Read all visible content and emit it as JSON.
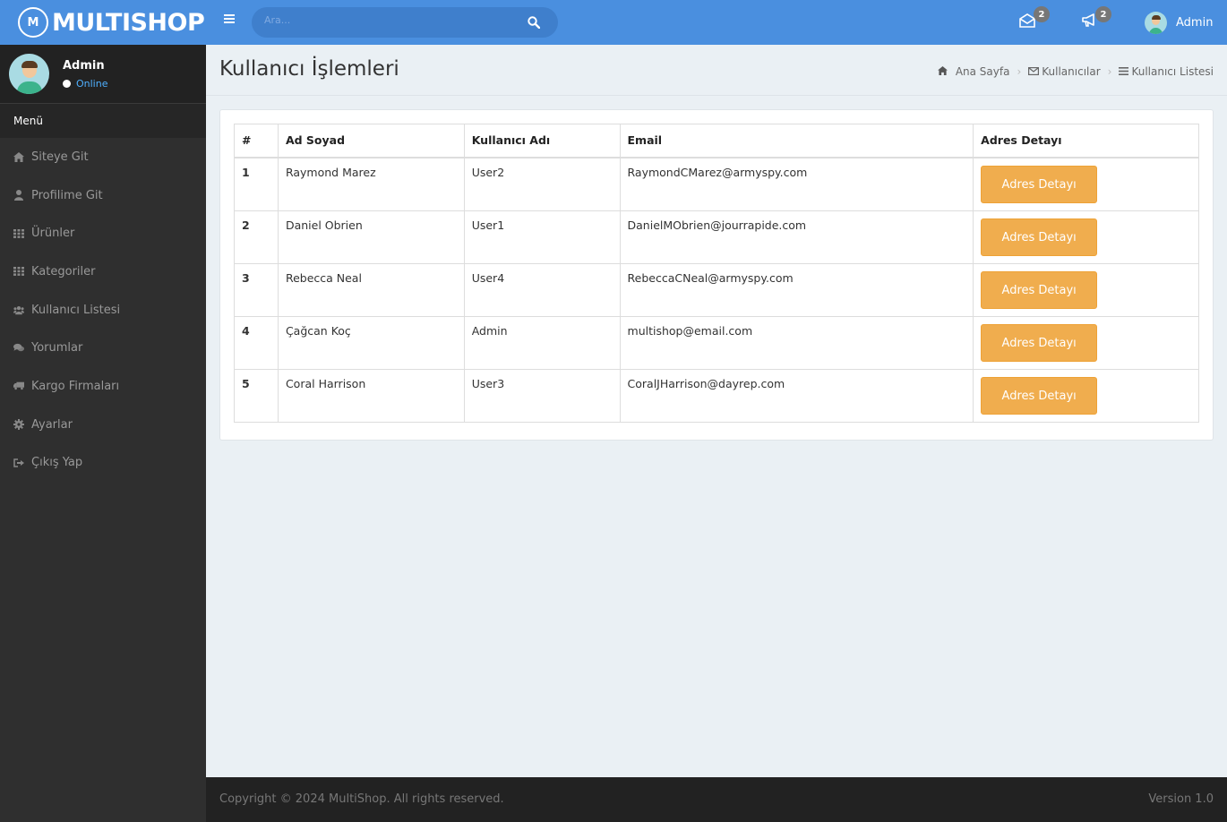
{
  "brand": {
    "name": "MULTISHOP",
    "logo_glyph": "M"
  },
  "user": {
    "name": "Admin",
    "status": "Online"
  },
  "sidebar": {
    "header": "Menü",
    "items": [
      {
        "label": "Siteye Git",
        "icon": "home-icon"
      },
      {
        "label": "Profilime Git",
        "icon": "user-icon"
      },
      {
        "label": "Ürünler",
        "icon": "grid-icon"
      },
      {
        "label": "Kategoriler",
        "icon": "grid-icon"
      },
      {
        "label": "Kullanıcı Listesi",
        "icon": "users-icon"
      },
      {
        "label": "Yorumlar",
        "icon": "comments-icon"
      },
      {
        "label": "Kargo Firmaları",
        "icon": "truck-icon"
      },
      {
        "label": "Ayarlar",
        "icon": "gear-icon"
      },
      {
        "label": "Çıkış Yap",
        "icon": "sign-out-icon"
      }
    ]
  },
  "topbar": {
    "search_placeholder": "Ara...",
    "messages_count": "2",
    "notifications_count": "2",
    "user_name": "Admin"
  },
  "page": {
    "title": "Kullanıcı İşlemleri",
    "breadcrumb": [
      "Ana Sayfa",
      "Kullanıcılar",
      "Kullanıcı Listesi"
    ]
  },
  "table": {
    "headers": [
      "#",
      "Ad Soyad",
      "Kullanıcı Adı",
      "Email",
      "Adres Detayı"
    ],
    "rows": [
      {
        "no": "1",
        "name": "Raymond Marez",
        "username": "User2",
        "email": "RaymondCMarez@armyspy.com",
        "action": "Adres Detayı"
      },
      {
        "no": "2",
        "name": "Daniel Obrien",
        "username": "User1",
        "email": "DanielMObrien@jourrapide.com",
        "action": "Adres Detayı"
      },
      {
        "no": "3",
        "name": "Rebecca Neal",
        "username": "User4",
        "email": "RebeccaCNeal@armyspy.com",
        "action": "Adres Detayı"
      },
      {
        "no": "4",
        "name": "Çağcan Koç",
        "username": "Admin",
        "email": "multishop@email.com",
        "action": "Adres Detayı"
      },
      {
        "no": "5",
        "name": "Coral Harrison",
        "username": "User3",
        "email": "CoralJHarrison@dayrep.com",
        "action": "Adres Detayı"
      }
    ]
  },
  "footer": {
    "copyright": "Copyright © 2024 MultiShop. All rights reserved.",
    "version": "Version 1.0"
  },
  "colors": {
    "primary": "#4a8fdf",
    "sidebar": "#2f2f2f",
    "warning": "#f0ad4e",
    "online": "#4fb0ff"
  }
}
